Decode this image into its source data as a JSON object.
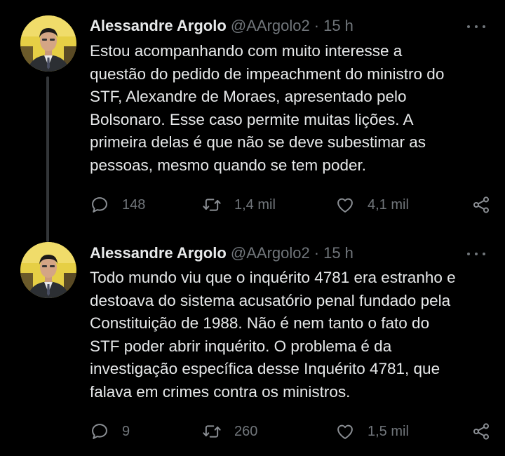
{
  "tweets": [
    {
      "author_name": "Alessandre Argolo",
      "handle": "@AArgolo2",
      "separator": "·",
      "time": "15 h",
      "text": "Estou acompanhando com muito interesse a\nquestão do pedido de impeachment do ministro do\nSTF, Alexandre de Moraes, apresentado pelo\nBolsonaro. Esse caso permite muitas lições. A\nprimeira delas é que não se deve subestimar as\npessoas, mesmo quando se tem poder.",
      "replies": "148",
      "retweets": "1,4 mil",
      "likes": "4,1 mil"
    },
    {
      "author_name": "Alessandre Argolo",
      "handle": "@AArgolo2",
      "separator": "·",
      "time": "15 h",
      "text": "Todo mundo viu que o inquérito 4781 era estranho e\ndestoava do sistema acusatório penal fundado pela\nConstituição de 1988. Não é nem tanto o fato do\nSTF poder abrir inquérito. O problema é da\ninvestigação específica desse Inquérito 4781, que\nfalava em crimes contra os ministros.",
      "replies": "9",
      "retweets": "260",
      "likes": "1,5 mil"
    }
  ],
  "icons": {
    "reply": "reply-icon",
    "retweet": "retweet-icon",
    "like": "heart-icon",
    "share": "share-icon",
    "more": "more-icon"
  },
  "colors": {
    "background": "#000000",
    "text": "#e7e9ea",
    "secondary": "#71767b",
    "thread_line": "#333639",
    "avatar_bg": "#e8d24a"
  }
}
